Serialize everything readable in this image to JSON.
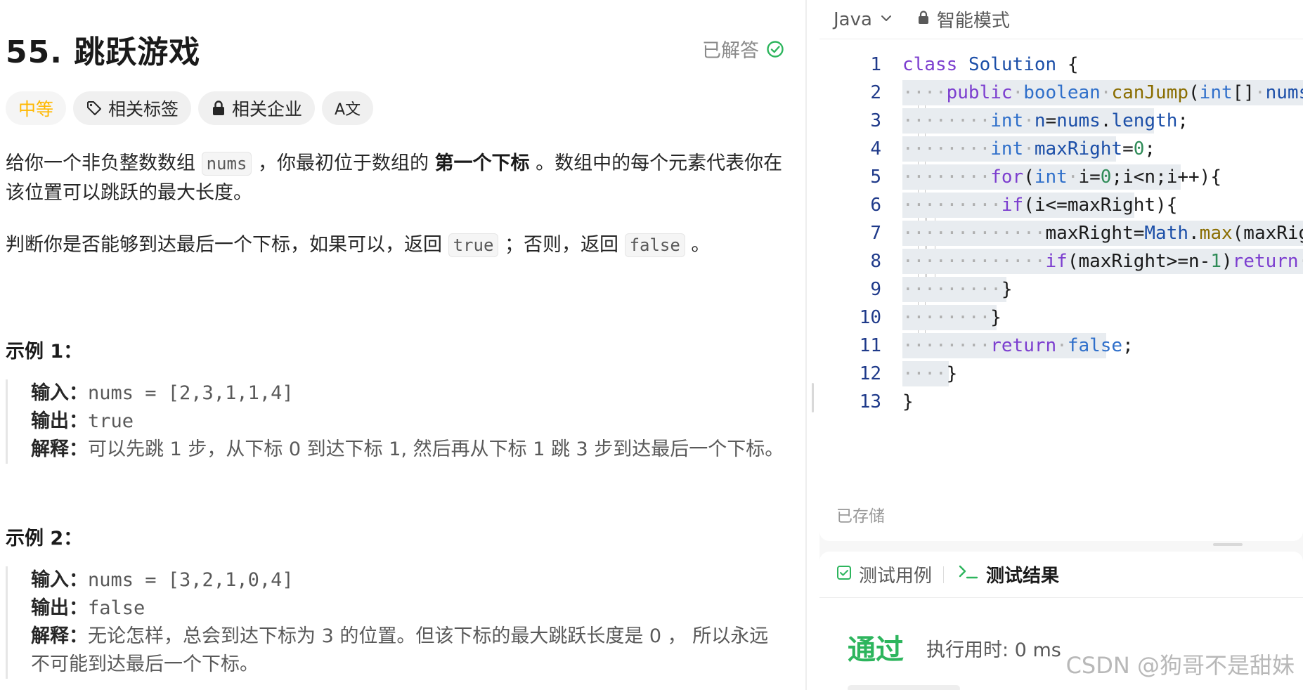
{
  "problem": {
    "title": "55. 跳跃游戏",
    "solved_label": "已解答",
    "tags": {
      "difficulty": "中等",
      "related_tags": "相关标签",
      "related_companies": "相关企业",
      "translate": "A文"
    },
    "desc1": {
      "a": "给你一个非负整数数组 ",
      "code": "nums",
      "b": " ，你最初位于数组的 ",
      "bold": "第一个下标",
      "c": " 。数组中的每个元素代表你在该位置可以跳跃的最大长度。"
    },
    "desc2": {
      "a": "判断你是否能够到达最后一个下标，如果可以，返回 ",
      "code1": "true",
      "b": " ；否则，返回 ",
      "code2": "false",
      "c": " 。"
    },
    "examples": [
      {
        "title": "示例 1：",
        "input_label": "输入：",
        "input": "nums = [2,3,1,1,4]",
        "output_label": "输出：",
        "output": "true",
        "explain_label": "解释：",
        "explain": "可以先跳 1 步，从下标 0 到达下标 1, 然后再从下标 1 跳 3 步到达最后一个下标。"
      },
      {
        "title": "示例 2：",
        "input_label": "输入：",
        "input": "nums = [3,2,1,0,4]",
        "output_label": "输出：",
        "output": "false",
        "explain_label": "解释：",
        "explain": "无论怎样，总会到达下标为 3 的位置。但该下标的最大跳跃长度是 0 ， 所以永远不可能到达最后一个下标。"
      }
    ]
  },
  "editor": {
    "language": "Java",
    "mode": "智能模式",
    "saved": "已存储",
    "line_numbers": [
      "1",
      "2",
      "3",
      "4",
      "5",
      "6",
      "7",
      "8",
      "9",
      "10",
      "11",
      "12",
      "13"
    ]
  },
  "result": {
    "tab_testcase": "测试用例",
    "tab_result": "测试结果",
    "status": "通过",
    "runtime": "执行用时: 0 ms"
  },
  "watermark": "CSDN @狗哥不是甜妹",
  "colors": {
    "difficulty": "#ffb800",
    "accepted": "#2db55d",
    "keyword": "#7c3ecf",
    "type": "#2f6fca"
  }
}
